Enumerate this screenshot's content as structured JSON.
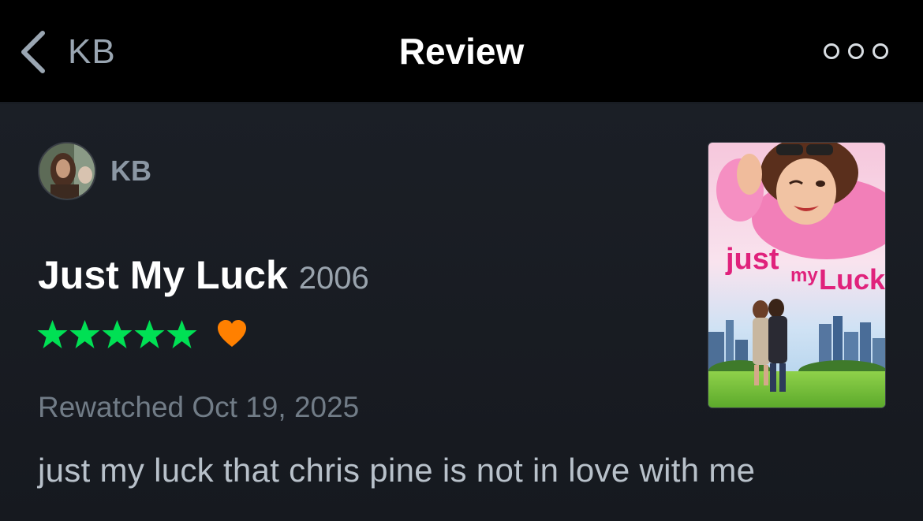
{
  "header": {
    "back_label": "KB",
    "title": "Review",
    "back_icon": "chevron-left-icon",
    "more_icon": "ellipsis-icon"
  },
  "review": {
    "author": "KB",
    "film_title": "Just My Luck",
    "film_year": "2006",
    "rating_stars": 5,
    "liked": true,
    "watched_label": "Rewatched Oct 19, 2025",
    "text": "just my luck that chris pine is not in love with me"
  },
  "poster": {
    "title_art": "just my Luck"
  },
  "colors": {
    "star": "#00e054",
    "heart": "#ff8000",
    "background": "#14181c",
    "topbar": "#000000"
  }
}
